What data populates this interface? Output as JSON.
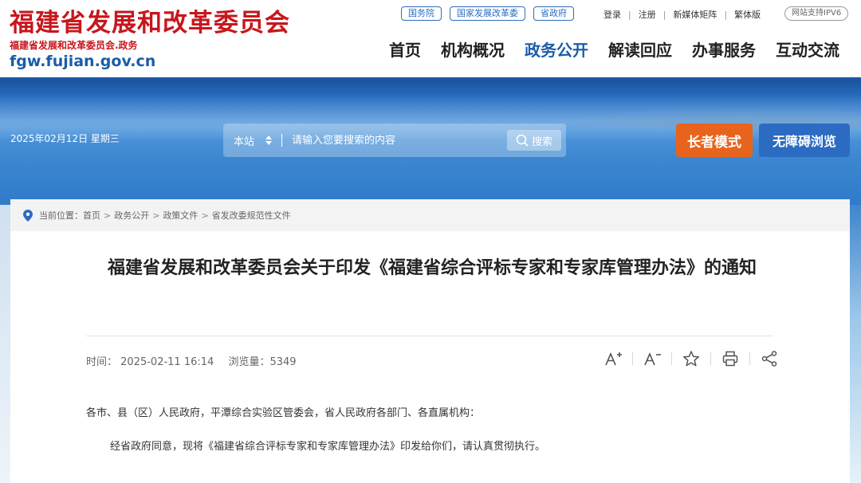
{
  "header": {
    "site_title": "福建省发展和改革委员会",
    "site_subtitle": "福建省发展和改革委员会.政务",
    "site_domain": "fgw.fujian.gov.cn",
    "top_links": [
      "国务院",
      "国家发展改革委",
      "省政府"
    ],
    "util_links": [
      "登录",
      "注册",
      "新媒体矩阵",
      "繁体版"
    ],
    "ipv6_badge": "网站支持IPV6",
    "nav": [
      "首页",
      "机构概况",
      "政务公开",
      "解读回应",
      "办事服务",
      "互动交流"
    ],
    "nav_active": "政务公开"
  },
  "banner": {
    "date": "2025年02月12日 星期三",
    "search_scope": "本站",
    "search_placeholder": "请输入您要搜索的内容",
    "search_button": "搜索",
    "elder_mode": "长者模式",
    "accessible_browse": "无障碍浏览"
  },
  "breadcrumb": {
    "label": "当前位置：",
    "items": [
      "首页",
      "政务公开",
      "政策文件",
      "省发改委规范性文件"
    ]
  },
  "article": {
    "title": "福建省发展和改革委员会关于印发《福建省综合评标专家和专家库管理办法》的通知",
    "time_label": "时间：",
    "time": "2025-02-11 16:14",
    "views_label": "浏览量：",
    "views": "5349",
    "tools": [
      "font-increase-icon",
      "font-decrease-icon",
      "star-icon",
      "print-icon",
      "share-icon"
    ],
    "paragraphs": [
      "各市、县（区）人民政府，平潭综合实验区管委会，省人民政府各部门、各直属机构：",
      "经省政府同意，现将《福建省综合评标专家和专家库管理办法》印发给你们，请认真贯彻执行。"
    ]
  },
  "colors": {
    "brand_red": "#c8161d",
    "brand_blue": "#1a5da8",
    "elder_orange": "#e8641c",
    "access_blue": "#2b6bc2"
  }
}
